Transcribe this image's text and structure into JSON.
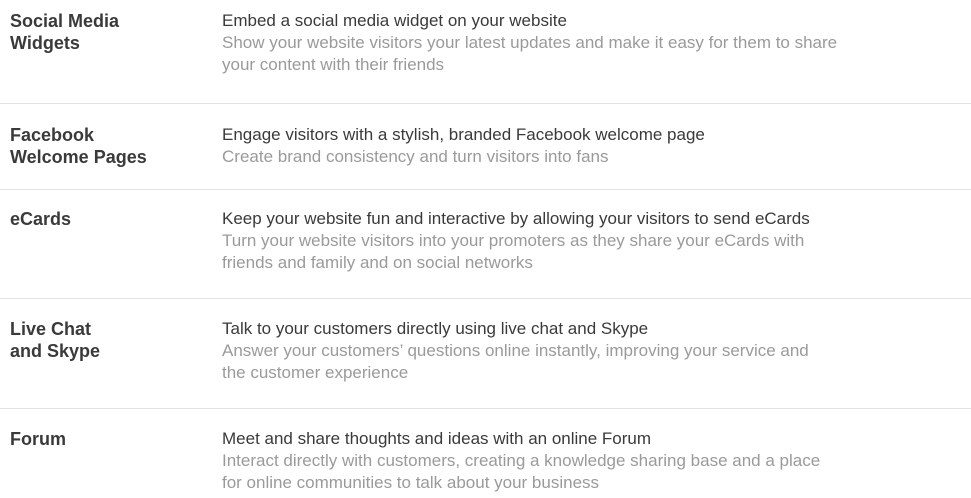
{
  "features": [
    {
      "name": "Social Media\nWidgets",
      "headline": "Embed a social media widget on your website",
      "description": "Show your website visitors your latest updates and make it easy for them to share\nyour content with their friends"
    },
    {
      "name": "Facebook\nWelcome Pages",
      "headline": "Engage visitors with a stylish, branded Facebook welcome page",
      "description": "Create brand consistency and turn visitors into fans"
    },
    {
      "name": "eCards",
      "headline": "Keep your website fun and interactive by allowing your visitors to send eCards",
      "description": "Turn your website visitors into your promoters as they share your eCards with\nfriends and family and on social networks"
    },
    {
      "name": "Live Chat\nand Skype",
      "headline": "Talk to your customers directly using live chat and Skype",
      "description": "Answer your customers’ questions online instantly, improving your service and\nthe customer experience"
    },
    {
      "name": "Forum",
      "headline": "Meet and share thoughts and ideas with an online Forum",
      "description": "Interact directly with customers, creating a knowledge sharing base and a place\nfor online communities to talk about your business"
    }
  ]
}
